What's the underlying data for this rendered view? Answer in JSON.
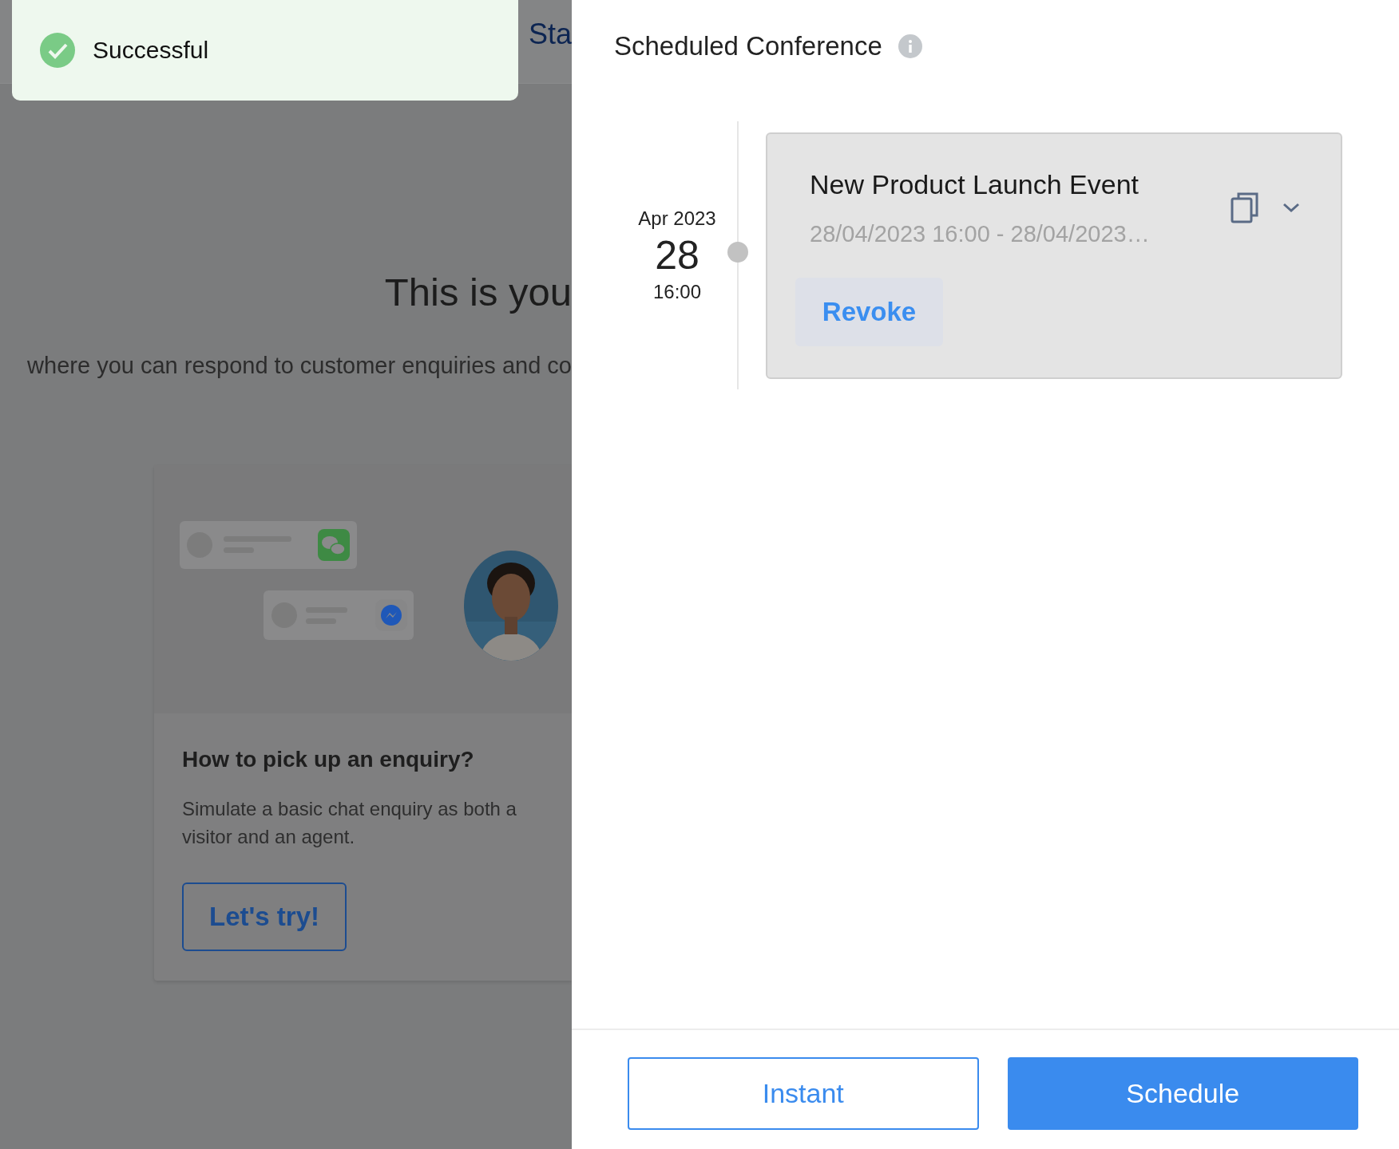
{
  "toast": {
    "kind": "success",
    "message": "Successful"
  },
  "background_page": {
    "header_text": "Sta",
    "heading": "This is you",
    "subtitle": "where you can respond to customer enquiries and co",
    "card": {
      "title": "How to pick up an enquiry?",
      "description": "Simulate a basic chat enquiry as both a visitor and an agent.",
      "button": "Let's try!"
    }
  },
  "drawer": {
    "title": "Scheduled Conference",
    "conferences": [
      {
        "month": "Apr 2023",
        "day": "28",
        "time": "16:00",
        "title": "New Product Launch Event",
        "range": "28/04/2023 16:00 - 28/04/2023…",
        "action": "Revoke",
        "expanded": false
      }
    ],
    "buttons": [
      {
        "label": "Instant",
        "kind": "outline"
      },
      {
        "label": "Schedule",
        "kind": "primary"
      }
    ]
  }
}
